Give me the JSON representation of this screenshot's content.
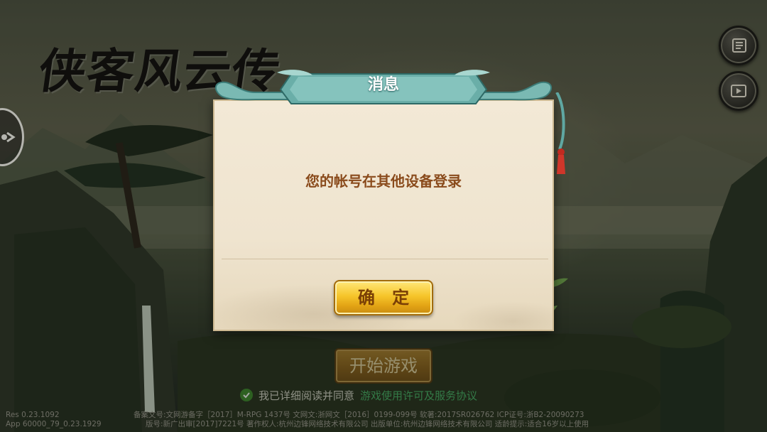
{
  "game": {
    "title": "侠客风云传"
  },
  "dialog": {
    "title": "消息",
    "message": "您的帐号在其他设备登录",
    "confirm_label": "确 定"
  },
  "login": {
    "start_label": "开始游戏",
    "agree_text": "我已详细阅读并同意",
    "agree_link": "游戏使用许可及服务协议",
    "agree_checked": true
  },
  "side_buttons": {
    "notice_icon": "scroll-icon",
    "video_icon": "video-play-icon",
    "left_icon": "share-arrow-icon"
  },
  "footer": {
    "res_version": "Res 0.23.1092",
    "app_version": "App 60000_79_0.23.1929",
    "license_line1": "备案文号:文网游备字［2017］M-RPG 1437号 文网文:浙网文［2016］0199-099号 软著:2017SR026762 ICP证号:浙B2-20090273",
    "license_line2": "版号:新广出审[2017]7221号 著作权人:杭州边锋网络技术有限公司 出版单位:杭州边锋网络技术有限公司 适龄提示:适合16岁以上使用"
  },
  "colors": {
    "accent_gold": "#f6c52a",
    "dialog_bg": "#f3e9d6",
    "message_text": "#8a4b1c",
    "header_teal": "#5fa7a2",
    "link_green": "#49b86a"
  }
}
